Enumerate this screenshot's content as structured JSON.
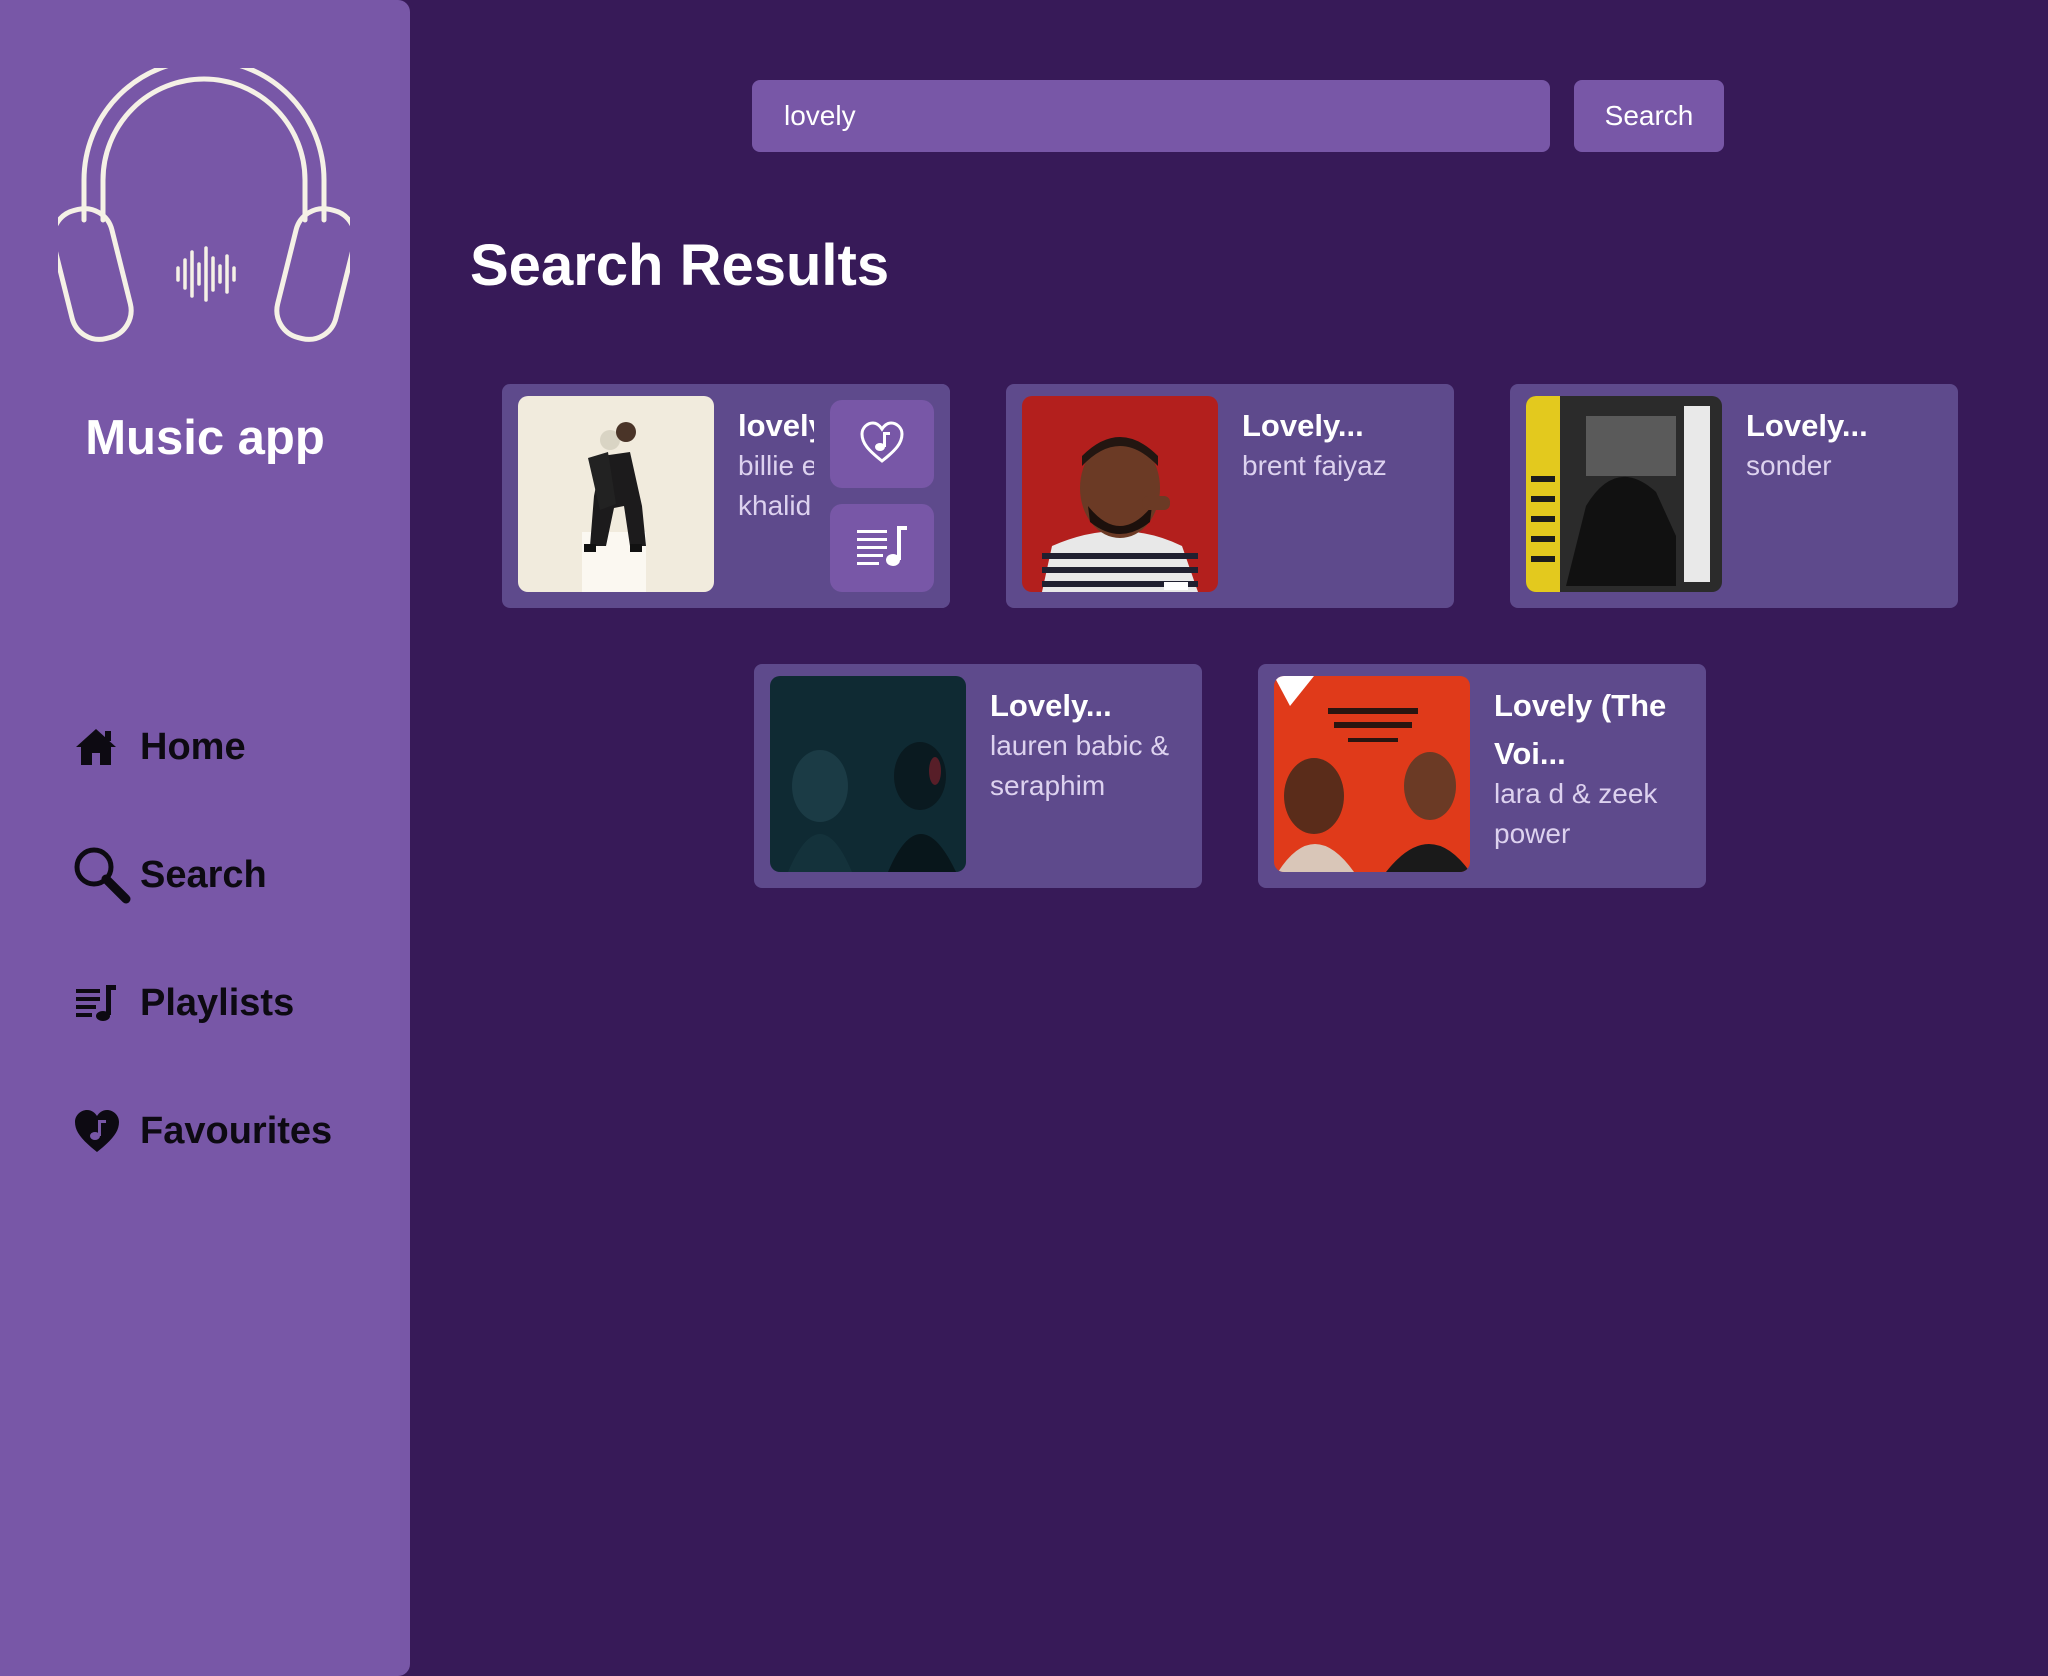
{
  "app": {
    "name": "Music app",
    "logo_icon": "headphones-icon"
  },
  "sidebar": {
    "items": [
      {
        "label": "Home",
        "icon": "home-icon"
      },
      {
        "label": "Search",
        "icon": "search-icon"
      },
      {
        "label": "Playlists",
        "icon": "playlist-icon"
      },
      {
        "label": "Favourites",
        "icon": "heart-music-icon"
      }
    ]
  },
  "search": {
    "value": "lovely",
    "placeholder": "",
    "button_label": "Search"
  },
  "results": {
    "title": "Search Results",
    "cards": [
      {
        "title": "lovely...",
        "artist": "billie eilish & khalid",
        "cover_icon": "album-cover"
      },
      {
        "title": "Lovely...",
        "artist": "brent faiyaz",
        "cover_icon": "album-cover"
      },
      {
        "title": "Lovely...",
        "artist": "sonder",
        "cover_icon": "album-cover"
      },
      {
        "title": "Lovely...",
        "artist": "lauren babic & seraphim",
        "cover_icon": "album-cover"
      },
      {
        "title": "Lovely (The Voi...",
        "artist": "lara d & zeek power",
        "cover_icon": "album-cover"
      }
    ],
    "card_actions": {
      "favourite_icon": "heart-music-icon",
      "add_to_playlist_icon": "playlist-add-icon"
    }
  },
  "colors": {
    "background": "#371a58",
    "sidebar": "#7857a7",
    "card": "#5e4a8c",
    "accent": "#7857a7",
    "text": "#ffffff",
    "nav_text": "#0d0a12"
  }
}
